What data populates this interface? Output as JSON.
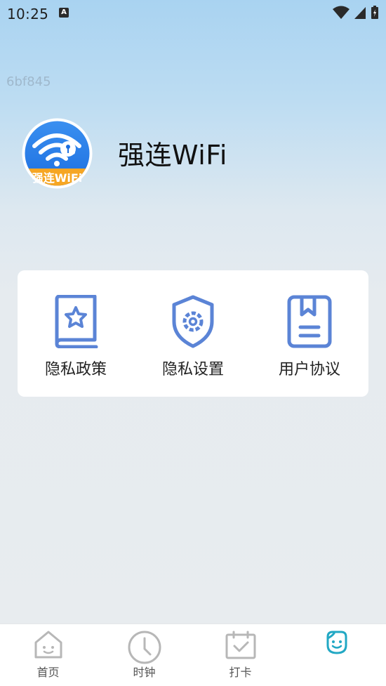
{
  "status_bar": {
    "time": "10:25",
    "notification_icon": "A"
  },
  "debug_id": "6bf845",
  "app": {
    "name": "强连WiFi",
    "logo_text": "强连WiFi"
  },
  "menu": {
    "items": [
      {
        "label": "隐私政策",
        "icon": "book-star-icon"
      },
      {
        "label": "隐私设置",
        "icon": "shield-gear-icon"
      },
      {
        "label": "用户协议",
        "icon": "document-bookmark-icon"
      }
    ]
  },
  "bottom_nav": {
    "items": [
      {
        "label": "首页",
        "icon": "home-icon"
      },
      {
        "label": "时钟",
        "icon": "clock-icon"
      },
      {
        "label": "打卡",
        "icon": "calendar-check-icon"
      },
      {
        "label": "",
        "icon": "smiley-face-icon",
        "active": true
      }
    ]
  },
  "colors": {
    "accent": "#5b84d6",
    "active_tab": "#22a8c4"
  }
}
